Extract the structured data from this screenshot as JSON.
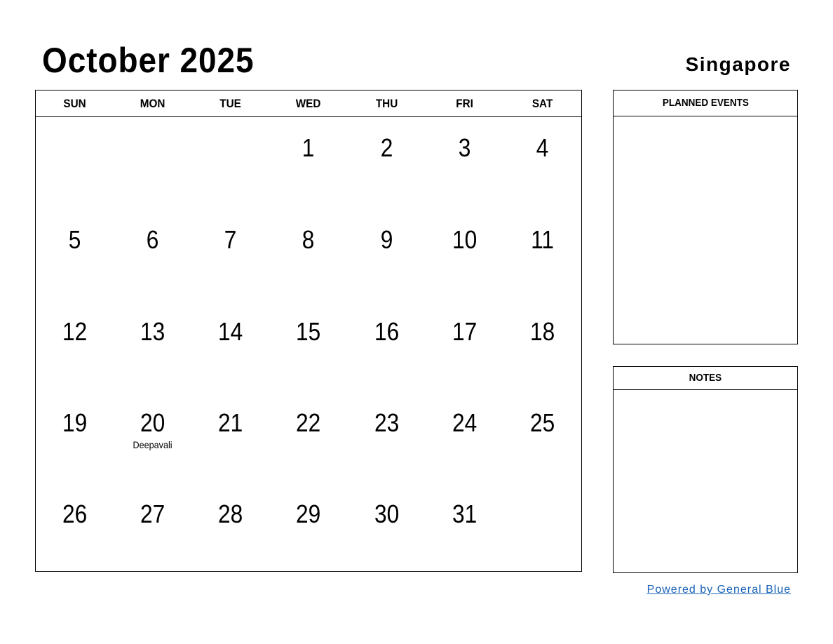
{
  "header": {
    "title": "October 2025",
    "country": "Singapore"
  },
  "calendar": {
    "weekdays": [
      "SUN",
      "MON",
      "TUE",
      "WED",
      "THU",
      "FRI",
      "SAT"
    ],
    "weeks": [
      [
        {
          "d": ""
        },
        {
          "d": ""
        },
        {
          "d": ""
        },
        {
          "d": "1"
        },
        {
          "d": "2"
        },
        {
          "d": "3"
        },
        {
          "d": "4"
        }
      ],
      [
        {
          "d": "5"
        },
        {
          "d": "6"
        },
        {
          "d": "7"
        },
        {
          "d": "8"
        },
        {
          "d": "9"
        },
        {
          "d": "10"
        },
        {
          "d": "11"
        }
      ],
      [
        {
          "d": "12"
        },
        {
          "d": "13"
        },
        {
          "d": "14"
        },
        {
          "d": "15"
        },
        {
          "d": "16"
        },
        {
          "d": "17"
        },
        {
          "d": "18"
        }
      ],
      [
        {
          "d": "19"
        },
        {
          "d": "20",
          "h": "Deepavali"
        },
        {
          "d": "21"
        },
        {
          "d": "22"
        },
        {
          "d": "23"
        },
        {
          "d": "24"
        },
        {
          "d": "25"
        }
      ],
      [
        {
          "d": "26"
        },
        {
          "d": "27"
        },
        {
          "d": "28"
        },
        {
          "d": "29"
        },
        {
          "d": "30"
        },
        {
          "d": "31"
        },
        {
          "d": ""
        }
      ]
    ]
  },
  "panels": {
    "planned_events": "PLANNED EVENTS",
    "notes": "NOTES"
  },
  "footer": {
    "link_text": "Powered by General Blue",
    "link_color": "#1a63b8"
  }
}
